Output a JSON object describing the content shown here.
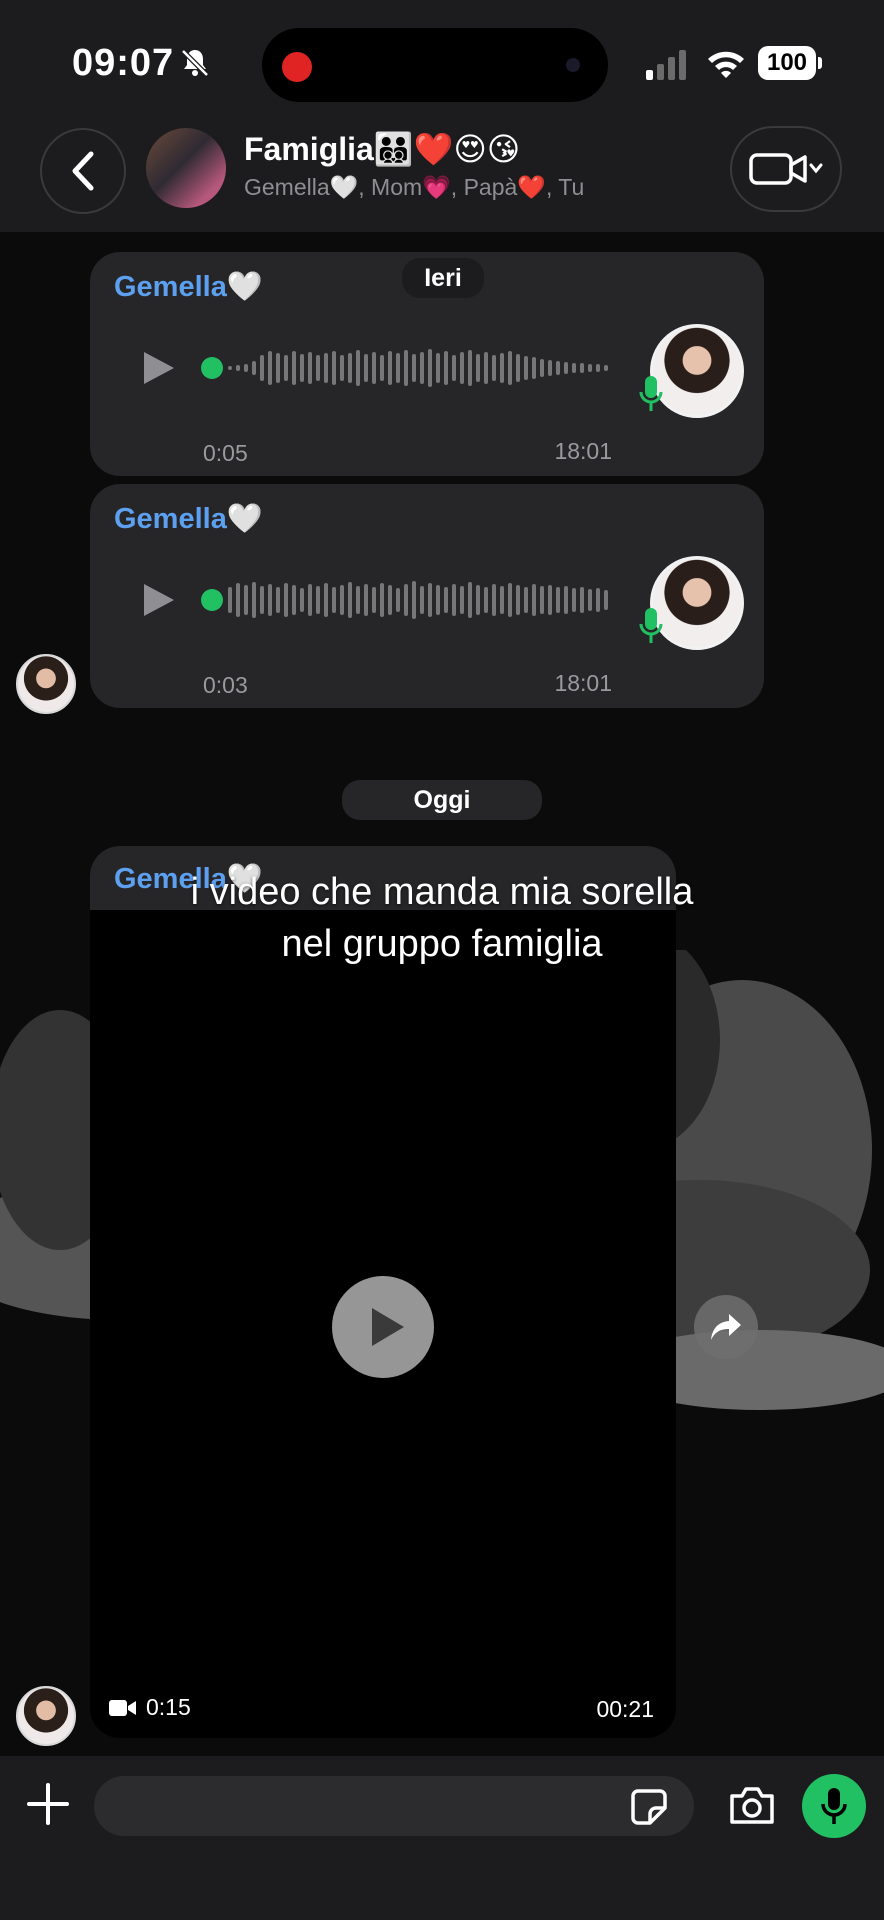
{
  "status_bar": {
    "time": "09:07",
    "battery": "100"
  },
  "header": {
    "group_name": "Famiglia🧑‍🧑‍🧒‍🧒❤️😍😘",
    "members": "Gemella🤍, Mom💗, Papà❤️, Tu"
  },
  "date_separators": {
    "yesterday": "Ieri",
    "today": "Oggi"
  },
  "messages": [
    {
      "sender": "Gemella🤍",
      "type": "voice",
      "duration": "0:05",
      "time": "18:01"
    },
    {
      "sender": "Gemella🤍",
      "type": "voice",
      "duration": "0:03",
      "time": "18:01"
    },
    {
      "sender": "Gemella🤍",
      "type": "video",
      "duration": "0:15",
      "time": "00:21"
    }
  ],
  "caption": {
    "line1": "i video che manda mia sorella",
    "line2": "nel gruppo famiglia"
  },
  "composer": {
    "placeholder": ""
  },
  "colors": {
    "accent_green": "#21c063",
    "sender_blue": "#5da0f0",
    "bubble": "#262628"
  }
}
